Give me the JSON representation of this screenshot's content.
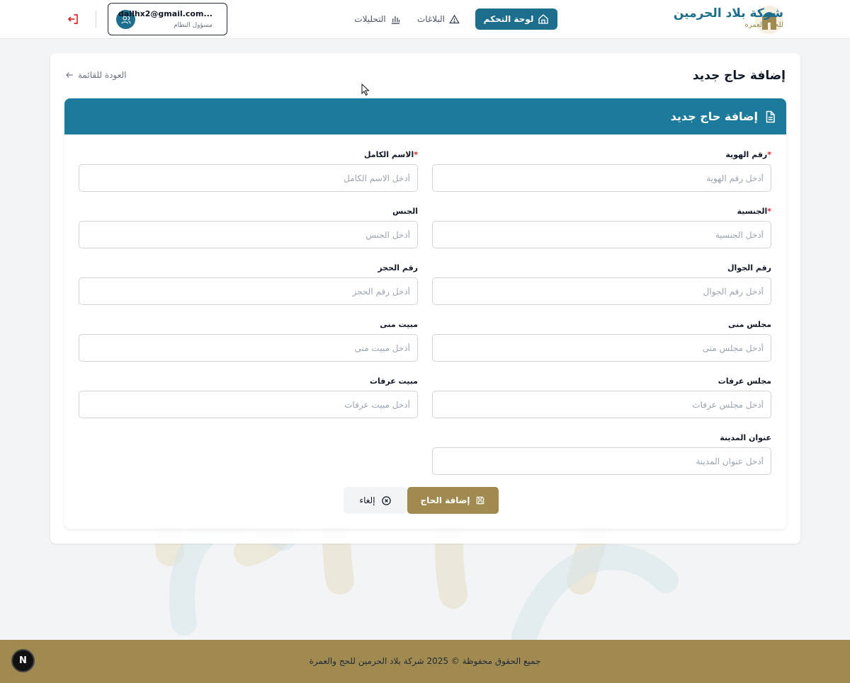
{
  "header": {
    "brand_name": "شركة بلاد الحرمين",
    "brand_sub": "للحج والعمرة",
    "nav": {
      "dashboard": "لوحة التحكم",
      "reports": "البلاغات",
      "analytics": "التحليلات"
    },
    "user": {
      "email": "dallhx2@gmail.com...",
      "role": "مسؤول النظام"
    }
  },
  "page": {
    "title": "إضافة حاج جديد",
    "back_label": "العودة للقائمة"
  },
  "form": {
    "header_title": "إضافة حاج جديد",
    "fields": {
      "id_number": {
        "label": "رقم الهوية",
        "required": "*",
        "placeholder": "أدخل رقم الهوية",
        "value": ""
      },
      "full_name": {
        "label": "الاسم الكامل",
        "required": "*",
        "placeholder": "أدخل الاسم الكامل",
        "value": ""
      },
      "nationality": {
        "label": "الجنسية",
        "required": "*",
        "placeholder": "أدخل الجنسية",
        "value": ""
      },
      "gender": {
        "label": "الجنس",
        "placeholder": "أدخل الجنس",
        "value": ""
      },
      "mobile": {
        "label": "رقم الجوال",
        "placeholder": "أدخل رقم الجوال",
        "value": ""
      },
      "booking": {
        "label": "رقم الحجز",
        "placeholder": "أدخل رقم الحجز",
        "value": ""
      },
      "mina_council": {
        "label": "مجلس منى",
        "placeholder": "أدخل مجلس منى",
        "value": ""
      },
      "mina_stay": {
        "label": "مبيت منى",
        "placeholder": "أدخل مبيت منى",
        "value": ""
      },
      "arafat_council": {
        "label": "مجلس عرفات",
        "placeholder": "أدخل مجلس عرفات",
        "value": ""
      },
      "arafat_stay": {
        "label": "مبيت عرفات",
        "placeholder": "أدخل مبيت عرفات",
        "value": ""
      },
      "madinah_address": {
        "label": "عنوان المدينة",
        "placeholder": "أدخل عنوان المدينة",
        "value": ""
      }
    },
    "submit_label": "إضافة الحاج",
    "cancel_label": "إلغاء"
  },
  "footer": {
    "text": "جميع الحقوق محفوظة © 2025 شركة بلاد الحرمين للحج والعمرة",
    "badge": "N"
  },
  "colors": {
    "primary": "#1c6e8c",
    "form_header": "#1c7a9c",
    "gold": "#a08a50",
    "required": "#dc2626"
  },
  "icons": {
    "dashboard": "home-icon",
    "reports": "warning-triangle-icon",
    "analytics": "bar-chart-icon",
    "user": "users-icon",
    "logout": "logout-icon",
    "back": "arrow-left-icon",
    "form": "document-icon",
    "submit": "save-icon",
    "cancel": "x-circle-icon"
  }
}
